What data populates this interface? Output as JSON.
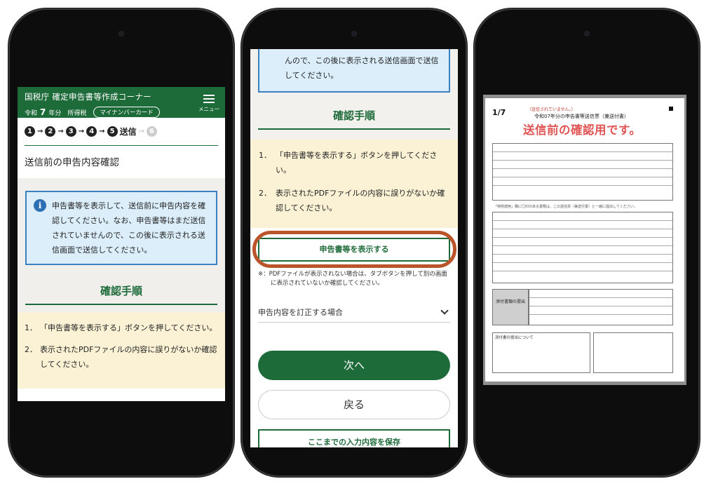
{
  "screen1": {
    "header": {
      "title": "国税庁 確定申告書等作成コーナー",
      "era": "令和",
      "year": "7",
      "year_suffix": "年分",
      "tax_type": "所得税",
      "mynumber_button": "マイナンバーカード",
      "menu_label": "メニュー"
    },
    "steps": {
      "items": [
        "1",
        "2",
        "3",
        "4",
        "5"
      ],
      "current_label": "送信",
      "next": "6"
    },
    "page_title": "送信前の申告内容確認",
    "info_text": "申告書等を表示して、送信前に申告内容を確認してください。なお、申告書等はまだ送信されていませんので、この後に表示される送信画面で送信してください。",
    "section_title": "確認手順",
    "procedure": [
      {
        "num": "1．",
        "text": "「申告書等を表示する」ボタンを押してください。"
      },
      {
        "num": "2．",
        "text": "表示されたPDFファイルの内容に誤りがないか確認してください。"
      }
    ]
  },
  "screen2": {
    "info_tail": "んので、この後に表示される送信画面で送信してください。",
    "section_title": "確認手順",
    "procedure": [
      {
        "num": "1．",
        "text": "「申告書等を表示する」ボタンを押してください。"
      },
      {
        "num": "2．",
        "text": "表示されたPDFファイルの内容に誤りがないか確認してください。"
      }
    ],
    "pdf_button": "申告書等を表示する",
    "note": "※：PDFファイルが表示されない場合は、タブボタンを押して別の画面に表示されていないか確認してください。",
    "accordion_label": "申告内容を訂正する場合",
    "next_button": "次へ",
    "back_button": "戻る",
    "save_button": "ここまでの入力内容を保存"
  },
  "screen3": {
    "page_indicator": "1/7",
    "warning": "（送信されていません。）",
    "doc_title": "令和07年分の申告書等送信票（兼送付書）",
    "overlay_text": "送信前の確認用です。",
    "gray_label": "添付書類の提出",
    "section_note": "「特例適用」欄に〇印のある書類は、この送信票（兼送付書）と一緒に提出してください。",
    "footer_heading": "添付書の提出について"
  },
  "colors": {
    "brand_green": "#1e6b3a",
    "info_blue": "#3b82c4",
    "highlight_orange": "#b9542b",
    "overlay_red": "#e05555",
    "cream": "#fbf2d5"
  }
}
